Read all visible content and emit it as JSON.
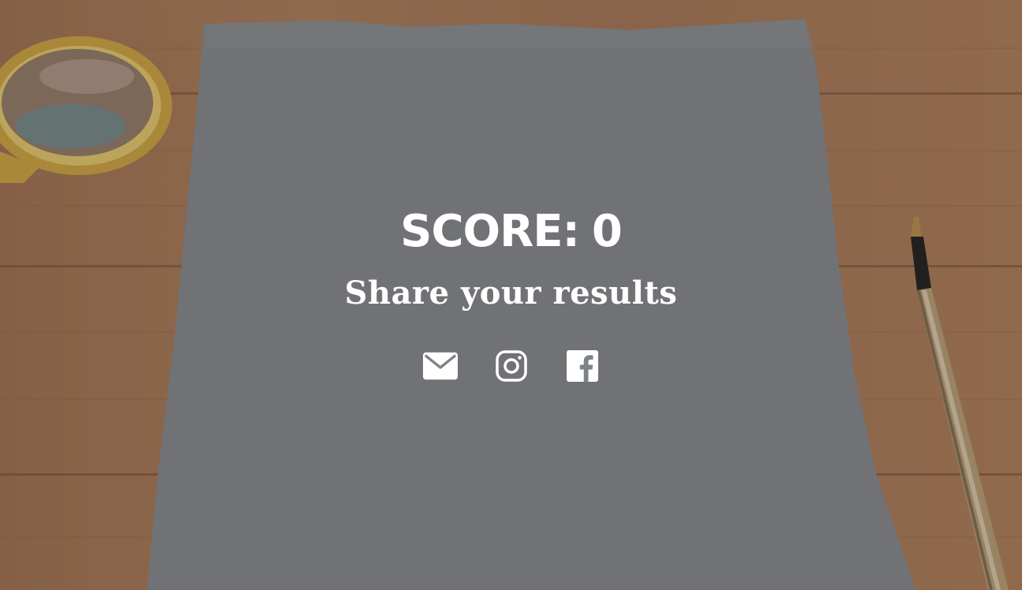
{
  "result": {
    "score_label": "SCORE:",
    "score_value": "0",
    "share_title": "Share your results"
  },
  "share_buttons": [
    {
      "name": "email",
      "icon": "mail-icon"
    },
    {
      "name": "instagram",
      "icon": "instagram-icon"
    },
    {
      "name": "facebook",
      "icon": "facebook-icon"
    }
  ],
  "colors": {
    "text": "#ffffff",
    "paper": "#7d8287",
    "wood": "#a87a58"
  }
}
